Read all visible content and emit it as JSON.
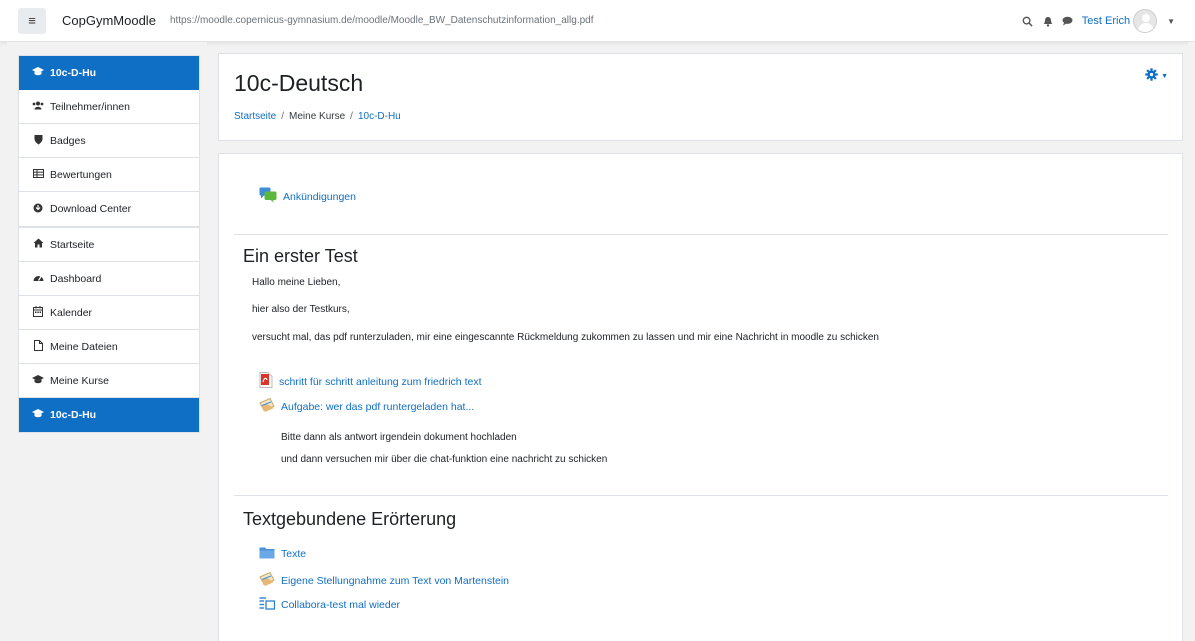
{
  "navbar": {
    "brand": "CopGymMoodle",
    "url": "https://moodle.copernicus-gymnasium.de/moodle/Moodle_BW_Datenschutzinformation_allg.pdf",
    "user_name": "Test Erich"
  },
  "sidebar": {
    "course_items": [
      {
        "label": "10c-D-Hu",
        "icon": "graduation-cap-icon",
        "active": true
      },
      {
        "label": "Teilnehmer/innen",
        "icon": "users-icon"
      },
      {
        "label": "Badges",
        "icon": "shield-icon"
      },
      {
        "label": "Bewertungen",
        "icon": "table-icon"
      },
      {
        "label": "Download Center",
        "icon": "download-circle-icon"
      }
    ],
    "site_items": [
      {
        "label": "Startseite",
        "icon": "home-icon"
      },
      {
        "label": "Dashboard",
        "icon": "dashboard-icon"
      },
      {
        "label": "Kalender",
        "icon": "calendar-icon"
      },
      {
        "label": "Meine Dateien",
        "icon": "file-icon"
      },
      {
        "label": "Meine Kurse",
        "icon": "graduation-cap-icon"
      },
      {
        "label": "10c-D-Hu",
        "icon": "graduation-cap-icon",
        "active": true
      }
    ]
  },
  "header": {
    "title": "10c-Deutsch",
    "breadcrumb": [
      "Startseite",
      "Meine Kurse",
      "10c-D-Hu"
    ]
  },
  "course": {
    "announcements": "Ankündigungen",
    "section1": {
      "title": "Ein erster Test",
      "summary": [
        "Hallo meine Lieben,",
        "hier also der Testkurs,",
        "versucht mal, das pdf runterzuladen, mir eine eingescannte Rückmeldung zukommen zu lassen und mir eine Nachricht in moodle zu schicken"
      ],
      "activities": [
        {
          "label": "schritt für schritt anleitung zum friedrich text",
          "icon": "pdf-icon"
        },
        {
          "label": "Aufgabe: wer das pdf runtergeladen hat...",
          "icon": "assignment-icon"
        }
      ],
      "notes": [
        "Bitte dann als antwort irgendein dokument hochladen",
        "und dann versuchen mir über die chat-funktion eine nachricht zu schicken"
      ]
    },
    "section2": {
      "title": "Textgebundene Erörterung",
      "activities": [
        {
          "label": "Texte",
          "icon": "folder-icon"
        },
        {
          "label": "Eigene Stellungnahme zum Text von Martenstein",
          "icon": "assignment-icon"
        },
        {
          "label": "Collabora-test mal wieder",
          "icon": "collabora-icon"
        }
      ]
    }
  },
  "colors": {
    "brand": "#0f6fc5",
    "background": "#f2f2f2"
  }
}
